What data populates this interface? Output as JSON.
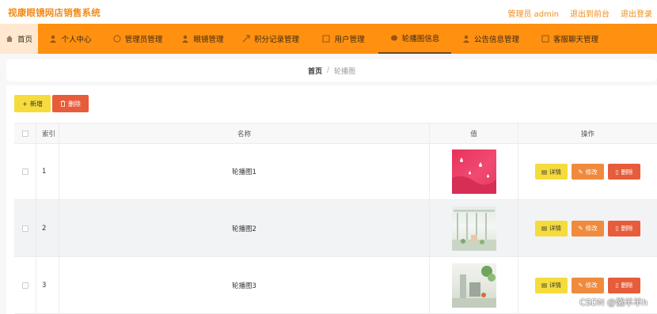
{
  "app": {
    "title": "视康眼镜网店销售系统",
    "admin_label": "管理员 admin",
    "back_front": "退出到前台",
    "logout": "退出登录"
  },
  "nav": {
    "items": [
      {
        "label": "首页",
        "icon": "home-icon"
      },
      {
        "label": "个人中心",
        "icon": "user-icon"
      },
      {
        "label": "管理员管理",
        "icon": "admin-icon"
      },
      {
        "label": "眼镜管理",
        "icon": "glasses-icon"
      },
      {
        "label": "积分记录管理",
        "icon": "points-icon"
      },
      {
        "label": "用户管理",
        "icon": "users-icon"
      },
      {
        "label": "轮播图信息",
        "icon": "carousel-icon"
      },
      {
        "label": "公告信息管理",
        "icon": "notice-icon"
      },
      {
        "label": "客服聊天管理",
        "icon": "chat-icon"
      }
    ]
  },
  "breadcrumb": {
    "home": "首页",
    "sep": "/",
    "current": "轮播图"
  },
  "toolbar": {
    "add": "新增",
    "delete": "删除"
  },
  "table": {
    "headers": {
      "index": "索引",
      "name": "名称",
      "value": "值",
      "ops": "操作"
    },
    "rows": [
      {
        "index": "1",
        "name": "轮播图1"
      },
      {
        "index": "2",
        "name": "轮播图2"
      },
      {
        "index": "3",
        "name": "轮播图3"
      }
    ],
    "ops": {
      "detail": "详情",
      "edit": "修改",
      "delete": "删除"
    }
  },
  "watermark": "CSDN @懒羊羊h",
  "colors": {
    "accent": "#ff9010",
    "brand_text": "#f08c1a",
    "add": "#f5dc3c",
    "edit": "#f08a3c",
    "delete": "#e75c3a"
  }
}
